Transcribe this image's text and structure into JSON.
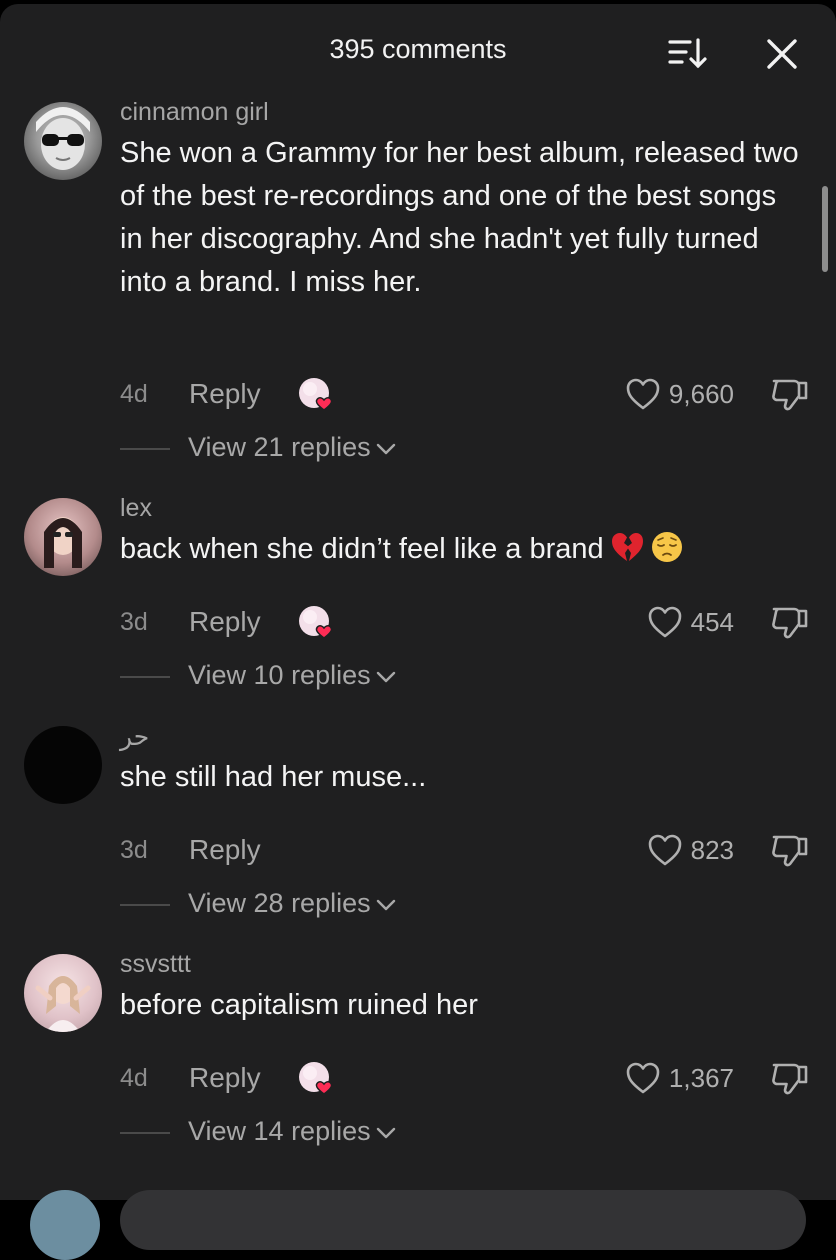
{
  "header": {
    "title": "395 comments"
  },
  "comments": [
    {
      "username": "cinnamon girl",
      "text": "She won a Grammy for her best album, released two of the best re-recordings and one of the best songs in her discography. And she hadn't yet fully turned into a brand. I miss her.",
      "age": "4d",
      "reply_label": "Reply",
      "likes": "9,660",
      "view_replies": "View 21 replies"
    },
    {
      "username": "lex",
      "text": "back when she didn’t feel like a brand",
      "emojis": [
        "💔",
        "😔"
      ],
      "age": "3d",
      "reply_label": "Reply",
      "likes": "454",
      "view_replies": "View 10 replies"
    },
    {
      "username": "حر",
      "text": "she still had her muse...",
      "age": "3d",
      "reply_label": "Reply",
      "likes": "823",
      "view_replies": "View 28 replies"
    },
    {
      "username": "ssvsttt",
      "text": "before capitalism ruined her",
      "age": "4d",
      "reply_label": "Reply",
      "likes": "1,367",
      "view_replies": "View 14 replies"
    }
  ],
  "colors": {
    "background": "#1f1f20",
    "accent_heart": "#fe2c55"
  },
  "icons": [
    "sort-icon",
    "close-icon",
    "heart-outline-icon",
    "dislike-icon",
    "chevron-down-icon",
    "creator-liked-icon"
  ]
}
